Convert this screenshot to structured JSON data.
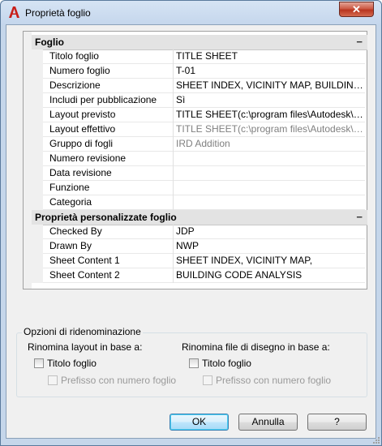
{
  "window": {
    "title": "Proprietà foglio",
    "close_glyph": "✕"
  },
  "grid": {
    "categories": [
      {
        "label": "Foglio",
        "toggle": "−",
        "rows": [
          {
            "name": "Titolo foglio",
            "value": "TITLE SHEET",
            "grey": false
          },
          {
            "name": "Numero foglio",
            "value": "T-01",
            "grey": false
          },
          {
            "name": "Descrizione",
            "value": "SHEET INDEX, VICINITY MAP, BUILDING C...",
            "grey": false
          },
          {
            "name": "Includi per pubblicazione",
            "value": "Sì",
            "grey": false
          },
          {
            "name": "Layout previsto",
            "value": "TITLE SHEET(c:\\program files\\Autodesk\\autoc...",
            "grey": false
          },
          {
            "name": "Layout effettivo",
            "value": "TITLE SHEET(c:\\program files\\Autodesk\\autoc...",
            "grey": true
          },
          {
            "name": "Gruppo di fogli",
            "value": "IRD Addition",
            "grey": true
          },
          {
            "name": "Numero revisione",
            "value": "",
            "grey": false
          },
          {
            "name": "Data revisione",
            "value": "",
            "grey": false
          },
          {
            "name": "Funzione",
            "value": "",
            "grey": false
          },
          {
            "name": "Categoria",
            "value": "",
            "grey": false
          }
        ]
      },
      {
        "label": "Proprietà personalizzate foglio",
        "toggle": "−",
        "rows": [
          {
            "name": "Checked By",
            "value": "JDP",
            "grey": false
          },
          {
            "name": "Drawn By",
            "value": "NWP",
            "grey": false
          },
          {
            "name": "Sheet Content 1",
            "value": "SHEET INDEX, VICINITY MAP,",
            "grey": false
          },
          {
            "name": "Sheet Content 2",
            "value": "BUILDING CODE ANALYSIS",
            "grey": false
          }
        ]
      }
    ]
  },
  "rename": {
    "group_label": "Opzioni di ridenominazione",
    "layout_header": "Rinomina layout in base a:",
    "file_header": "Rinomina file di disegno in base a:",
    "layout_title_option": "Titolo foglio",
    "layout_prefix_option": "Prefisso con numero foglio",
    "file_title_option": "Titolo foglio",
    "file_prefix_option": "Prefisso con numero foglio"
  },
  "buttons": {
    "ok": "OK",
    "cancel": "Annulla",
    "help": "?"
  }
}
